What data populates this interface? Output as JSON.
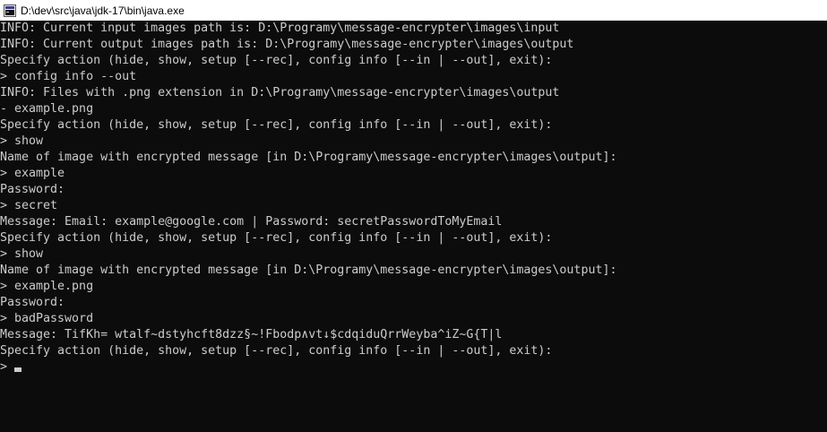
{
  "window": {
    "title": "D:\\dev\\src\\java\\jdk-17\\bin\\java.exe",
    "icon": "java-app-icon",
    "background": "#0c0c0c",
    "text_color": "#cccccc"
  },
  "console": {
    "lines": [
      "INFO: Current input images path is: D:\\Programy\\message-encrypter\\images\\input",
      "INFO: Current output images path is: D:\\Programy\\message-encrypter\\images\\output",
      "Specify action (hide, show, setup [--rec], config info [--in | --out], exit):",
      "> config info --out",
      "INFO: Files with .png extension in D:\\Programy\\message-encrypter\\images\\output",
      "- example.png",
      "Specify action (hide, show, setup [--rec], config info [--in | --out], exit):",
      "> show",
      "Name of image with encrypted message [in D:\\Programy\\message-encrypter\\images\\output]:",
      "> example",
      "Password:",
      "> secret",
      "Message: Email: example@google.com | Password: secretPasswordToMyEmail",
      "Specify action (hide, show, setup [--rec], config info [--in | --out], exit):",
      "> show",
      "Name of image with encrypted message [in D:\\Programy\\message-encrypter\\images\\output]:",
      "> example.png",
      "Password:",
      "> badPassword",
      "Message: TifKh= wtalf~dstyhcft8dzz§~!Fbodp∧vt↓$cdqiduQrrWeyba^iZ~G{T|l",
      "Specify action (hide, show, setup [--rec], config info [--in | --out], exit):"
    ],
    "prompt": "> "
  }
}
